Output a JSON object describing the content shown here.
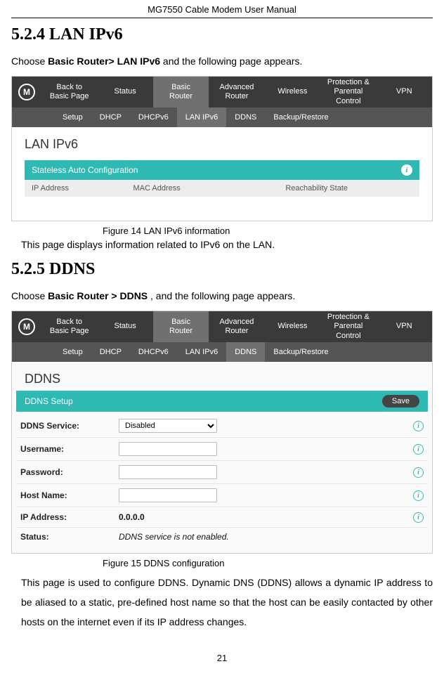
{
  "doc": {
    "header": "MG7550 Cable Modem User Manual",
    "pageNum": "21"
  },
  "sec1": {
    "heading": "5.2.4  LAN IPv6",
    "intro_a": "Choose ",
    "intro_b": "Basic Router> LAN IPv6",
    "intro_c": " and the following page appears.",
    "caption": "Figure 14 LAN IPv6 information",
    "desc": "This page displays information related to IPv6 on the LAN."
  },
  "sec2": {
    "heading": "5.2.5  DDNS",
    "intro_a": "Choose ",
    "intro_b": "Basic Router > DDNS ",
    "intro_c": ", and the following page appears.",
    "caption": "Figure 15 DDNS configuration",
    "desc": "This page is used to configure DDNS. Dynamic DNS (DDNS) allows a dynamic IP address to be aliased to a static, pre-defined host name so that the host can be easily contacted by other hosts on the internet even if its IP address changes."
  },
  "shot1": {
    "logo": "M",
    "topnav": [
      {
        "line1": "Back to",
        "line2": "Basic Page"
      },
      {
        "line1": "Status",
        "line2": ""
      },
      {
        "line1": "Basic",
        "line2": "Router"
      },
      {
        "line1": "Advanced",
        "line2": "Router"
      },
      {
        "line1": "Wireless",
        "line2": ""
      },
      {
        "line1": "Protection &",
        "line2": "Parental Control"
      },
      {
        "line1": "VPN",
        "line2": ""
      }
    ],
    "subnav": [
      "Setup",
      "DHCP",
      "DHCPv6",
      "LAN IPv6",
      "DDNS",
      "Backup/Restore"
    ],
    "subnav_active": "LAN IPv6",
    "title": "LAN IPv6",
    "band": "Stateless Auto Configuration",
    "cols": [
      "IP Address",
      "MAC Address",
      "Reachability State"
    ]
  },
  "shot2": {
    "logo": "M",
    "topnav": [
      {
        "line1": "Back to",
        "line2": "Basic Page"
      },
      {
        "line1": "Status",
        "line2": ""
      },
      {
        "line1": "Basic",
        "line2": "Router"
      },
      {
        "line1": "Advanced",
        "line2": "Router"
      },
      {
        "line1": "Wireless",
        "line2": ""
      },
      {
        "line1": "Protection &",
        "line2": "Parental Control"
      },
      {
        "line1": "VPN",
        "line2": ""
      }
    ],
    "subnav": [
      "Setup",
      "DHCP",
      "DHCPv6",
      "LAN IPv6",
      "DDNS",
      "Backup/Restore"
    ],
    "subnav_active": "DDNS",
    "title": "DDNS",
    "setup_header": "DDNS Setup",
    "save": "Save",
    "rows": {
      "service_label": "DDNS Service:",
      "service_value": "Disabled",
      "username_label": "Username:",
      "password_label": "Password:",
      "hostname_label": "Host Name:",
      "ip_label": "IP Address:",
      "ip_value": "0.0.0.0",
      "status_label": "Status:",
      "status_value": "DDNS service is not enabled."
    }
  }
}
